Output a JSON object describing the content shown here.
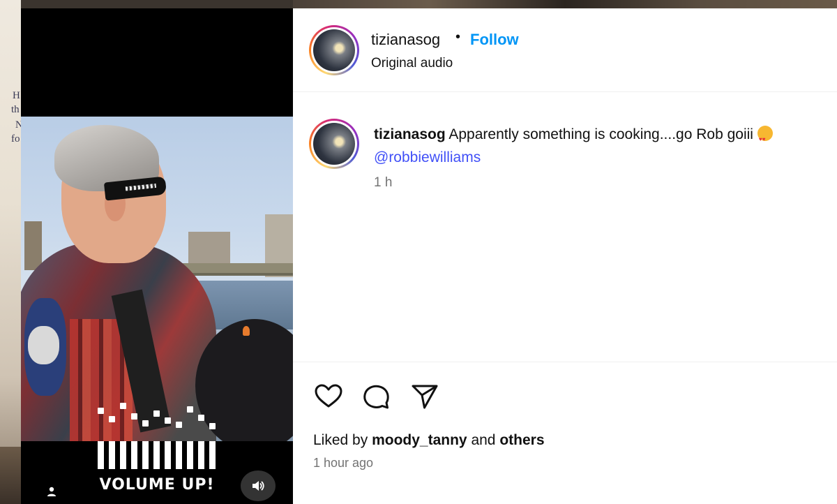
{
  "post": {
    "username": "tizianasog",
    "separator": "•",
    "follow_label": "Follow",
    "audio": "Original audio"
  },
  "caption": {
    "username": "tizianasog",
    "text": "Apparently something is cooking....go Rob goiii",
    "emoji": "smiling-face-with-heart-eyes",
    "mention": "@robbiewilliams",
    "time": "1 h"
  },
  "engagement": {
    "liked_prefix": "Liked by",
    "liked_user": "moody_tanny",
    "liked_mid": "and",
    "liked_others": "others",
    "posted_ago": "1 hour ago"
  },
  "media": {
    "overlay_text": "VOLUME UP!"
  },
  "backdrop": {
    "fragments": [
      "H",
      "th",
      "N",
      "fo"
    ]
  },
  "icons": {
    "like": "heart-icon",
    "comment": "comment-bubble-icon",
    "share": "paper-plane-icon",
    "mute": "speaker-icon",
    "tag": "user-tag-icon"
  },
  "colors": {
    "follow": "#0095f6",
    "mention": "#4150f7",
    "secondary_text": "#737373"
  }
}
